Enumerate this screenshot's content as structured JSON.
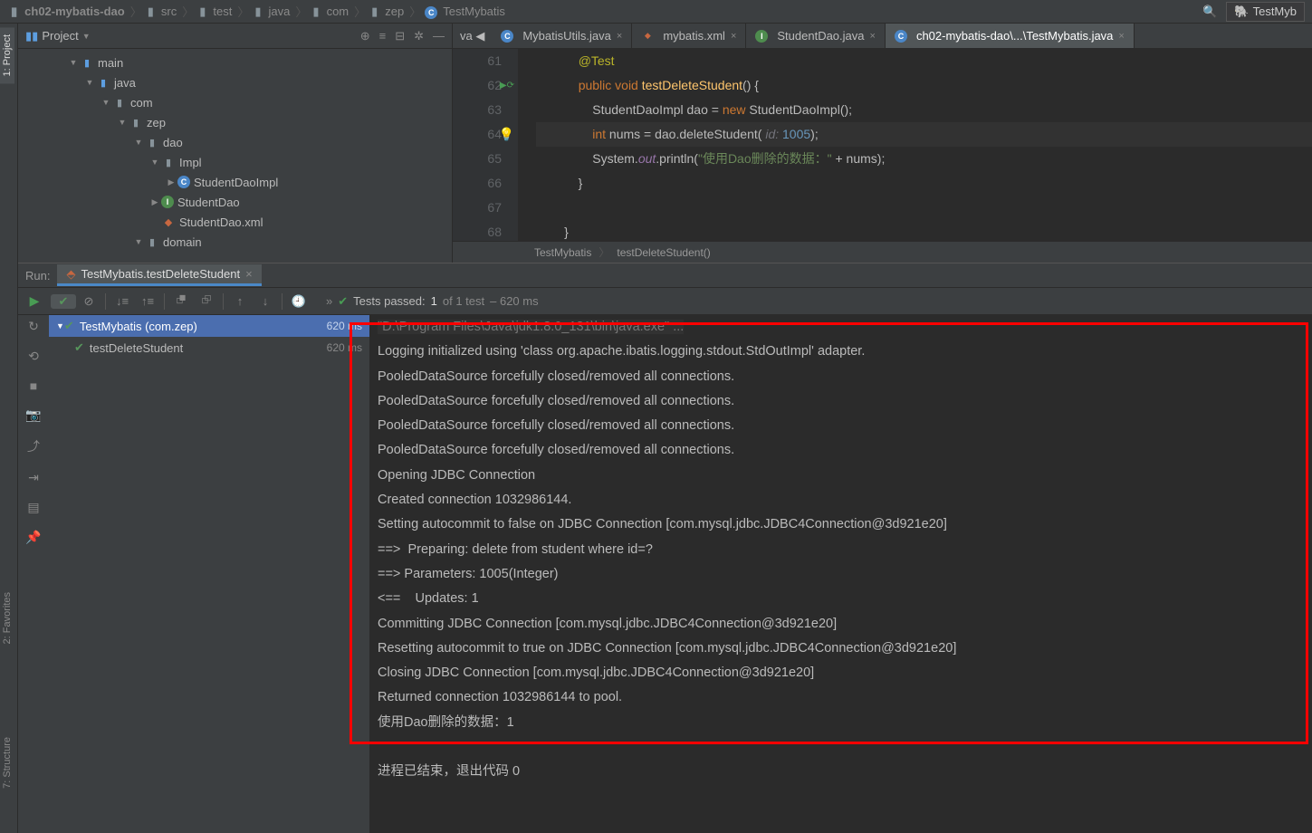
{
  "nav": {
    "crumbs": [
      "ch02-mybatis-dao",
      "src",
      "test",
      "java",
      "com",
      "zep",
      "TestMybatis"
    ],
    "right_tab": "TestMyb"
  },
  "project": {
    "title": "Project",
    "tree": [
      {
        "depth": 3,
        "tri": "▼",
        "icon": "folder",
        "label": "main"
      },
      {
        "depth": 4,
        "tri": "▼",
        "icon": "folder",
        "label": "java"
      },
      {
        "depth": 5,
        "tri": "▼",
        "icon": "fld-par",
        "label": "com"
      },
      {
        "depth": 6,
        "tri": "▼",
        "icon": "fld-par",
        "label": "zep"
      },
      {
        "depth": 7,
        "tri": "▼",
        "icon": "fld-par",
        "label": "dao"
      },
      {
        "depth": 8,
        "tri": "▼",
        "icon": "fld-par",
        "label": "Impl"
      },
      {
        "depth": 9,
        "tri": "▶",
        "icon": "jclass",
        "label": "StudentDaoImpl"
      },
      {
        "depth": 8,
        "tri": "▶",
        "icon": "jint",
        "label": "StudentDao"
      },
      {
        "depth": 8,
        "tri": "",
        "icon": "xml",
        "label": "StudentDao.xml"
      },
      {
        "depth": 7,
        "tri": "▼",
        "icon": "fld-par",
        "label": "domain"
      }
    ]
  },
  "tabs": [
    {
      "icon": "jclass",
      "label": "MybatisUtils.java",
      "active": false
    },
    {
      "icon": "xml",
      "label": "mybatis.xml",
      "active": false
    },
    {
      "icon": "jint",
      "label": "StudentDao.java",
      "active": false
    },
    {
      "icon": "jclass",
      "label": "ch02-mybatis-dao\\...\\TestMybatis.java",
      "active": true
    }
  ],
  "editor": {
    "lines": [
      {
        "n": 61,
        "html": "            <span class='ann'>@Test</span>"
      },
      {
        "n": 62,
        "html": "            <span class='kw'>public void</span> <span class='fn'>testDeleteStudent</span>() {",
        "run": true
      },
      {
        "n": 63,
        "html": "                StudentDaoImpl dao = <span class='kw'>new</span> StudentDaoImpl();"
      },
      {
        "n": 64,
        "html": "                <span class='kw'>int</span> nums = dao.deleteStudent(<span class='param'> id: </span><span class='nm'>1005</span>);",
        "hl": true,
        "bulb": true
      },
      {
        "n": 65,
        "html": "                System.<span class='fld'>out</span>.println(<span class='st'>\"使用Dao删除的数据：\"</span> + nums);"
      },
      {
        "n": 66,
        "html": "            }"
      },
      {
        "n": 67,
        "html": ""
      },
      {
        "n": 68,
        "html": "        }"
      }
    ],
    "breadcrumb": [
      "TestMybatis",
      "testDeleteStudent()"
    ]
  },
  "run": {
    "label": "Run:",
    "tab": "TestMybatis.testDeleteStudent",
    "status_prefix": "Tests passed:",
    "status_count": "1",
    "status_mid": "of 1 test",
    "status_time": "– 620 ms",
    "tests": [
      {
        "name": "TestMybatis (com.zep)",
        "dur": "620 ms",
        "sel": true,
        "depth": 0
      },
      {
        "name": "testDeleteStudent",
        "dur": "620 ms",
        "sel": false,
        "depth": 1
      }
    ],
    "console": [
      {
        "t": "\"D:\\Program Files\\Java\\jdk1.8.0_131\\bin\\java.exe\" ...",
        "cmd": true
      },
      {
        "t": "Logging initialized using 'class org.apache.ibatis.logging.stdout.StdOutImpl' adapter."
      },
      {
        "t": "PooledDataSource forcefully closed/removed all connections."
      },
      {
        "t": "PooledDataSource forcefully closed/removed all connections."
      },
      {
        "t": "PooledDataSource forcefully closed/removed all connections."
      },
      {
        "t": "PooledDataSource forcefully closed/removed all connections."
      },
      {
        "t": "Opening JDBC Connection"
      },
      {
        "t": "Created connection 1032986144."
      },
      {
        "t": "Setting autocommit to false on JDBC Connection [com.mysql.jdbc.JDBC4Connection@3d921e20]"
      },
      {
        "t": "==>  Preparing: delete from student where id=?"
      },
      {
        "t": "==> Parameters: 1005(Integer)"
      },
      {
        "t": "<==    Updates: 1"
      },
      {
        "t": "Committing JDBC Connection [com.mysql.jdbc.JDBC4Connection@3d921e20]"
      },
      {
        "t": "Resetting autocommit to true on JDBC Connection [com.mysql.jdbc.JDBC4Connection@3d921e20]"
      },
      {
        "t": "Closing JDBC Connection [com.mysql.jdbc.JDBC4Connection@3d921e20]"
      },
      {
        "t": "Returned connection 1032986144 to pool."
      },
      {
        "t": "使用Dao删除的数据：1"
      },
      {
        "t": ""
      },
      {
        "t": "进程已结束，退出代码 0"
      }
    ]
  }
}
